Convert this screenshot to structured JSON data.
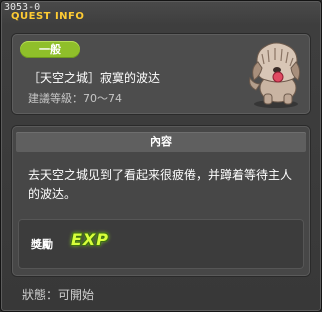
{
  "window": {
    "id_text": "3053-0",
    "title": "QUEST INFO"
  },
  "header": {
    "category": "一般",
    "quest_name": "［天空之城］寂寞的波达",
    "level_label": "建議等級：",
    "level_range": "70～74",
    "npc_icon": "npc-dog-portrait-icon"
  },
  "content": {
    "heading": "內容",
    "description": "去天空之城见到了看起来很疲倦，并蹲着等待主人的波达。"
  },
  "reward": {
    "label": "獎勵",
    "exp_text": "EXP"
  },
  "status": {
    "label": "狀態：",
    "value": "可開始"
  },
  "colors": {
    "title": "#ffcc33",
    "badge": "#8fbf2a",
    "exp": "#d8ff3a"
  }
}
